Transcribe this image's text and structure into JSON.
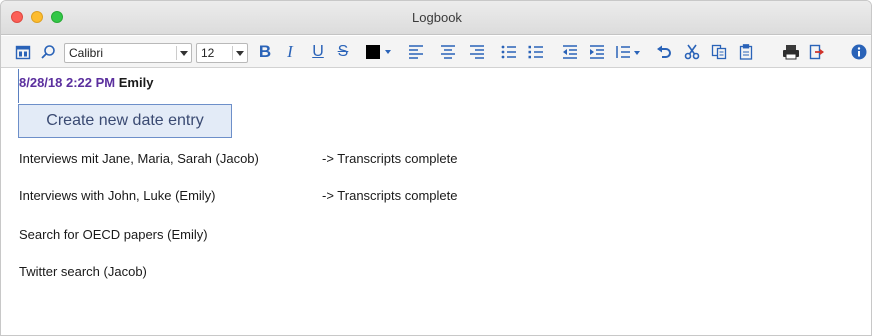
{
  "window": {
    "title": "Logbook"
  },
  "toolbar": {
    "font": "Calibri",
    "size": "12",
    "bold": "B",
    "italic": "I",
    "underline": "U",
    "strike": "S",
    "text_color": "#000000"
  },
  "entry": {
    "date": "8/28/18 2:22 PM",
    "author": "Emily"
  },
  "tooltip": "Create new date entry",
  "lines": [
    {
      "text": "Interviews mit Jane, Maria, Sarah (Jacob)",
      "note": "-> Transcripts complete"
    },
    {
      "text": "Interviews with John, Luke (Emily)",
      "note": "-> Transcripts complete"
    },
    {
      "text": "Search for OECD papers (Emily)",
      "note": ""
    },
    {
      "text": "Twitter search (Jacob)",
      "note": ""
    }
  ],
  "colors": {
    "icon_blue": "#2a63b8",
    "date_purple": "#5b2f9e",
    "tooltip_bg": "#e3ebf7",
    "tooltip_border": "#6d8fc9"
  }
}
